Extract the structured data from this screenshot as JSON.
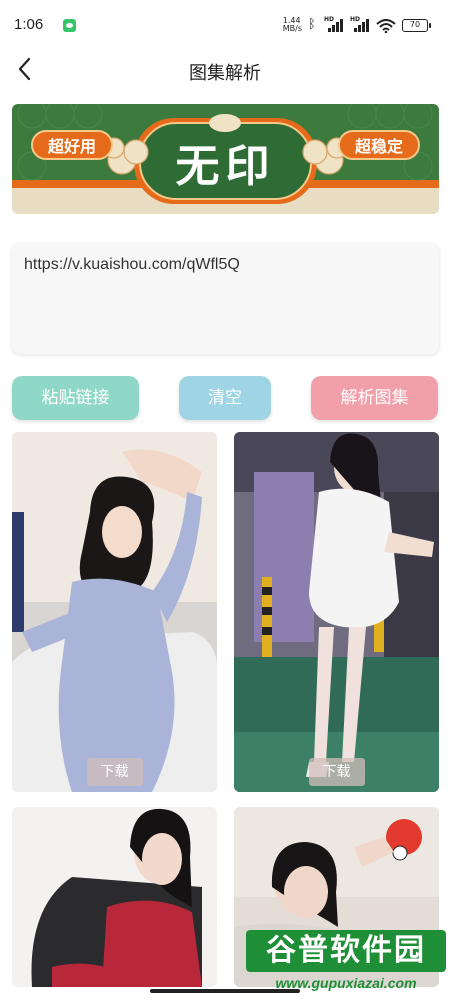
{
  "status_bar": {
    "time": "1:06",
    "net_speed_value": "1.44",
    "net_speed_unit": "MB/s",
    "signal_1_label": "HD",
    "signal_2_label": "HD",
    "battery": "70",
    "icons": [
      "wechat-icon",
      "bluetooth-icon",
      "signal-icon",
      "wifi-icon",
      "battery-icon"
    ]
  },
  "header": {
    "title": "图集解析",
    "back_icon": "chevron-left-icon"
  },
  "banner": {
    "left_badge": "超好用",
    "center_title": "无印",
    "right_badge": "超稳定",
    "colors": {
      "green": "#3c7a3e",
      "orange": "#e56a1a",
      "cream": "#e8dcc2"
    }
  },
  "url_input": {
    "value": "https://v.kuaishou.com/qWfl5Q",
    "placeholder": ""
  },
  "actions": {
    "paste_label": "粘贴链接",
    "clear_label": "清空",
    "parse_label": "解析图集"
  },
  "gallery": {
    "download_label": "下载",
    "items": [
      {
        "id": "photo-1",
        "download_label": "下载"
      },
      {
        "id": "photo-2",
        "download_label": "下载"
      },
      {
        "id": "photo-3"
      },
      {
        "id": "photo-4"
      }
    ]
  },
  "watermark": {
    "title": "谷普软件园",
    "url": "www.gupuxiazai.com"
  }
}
